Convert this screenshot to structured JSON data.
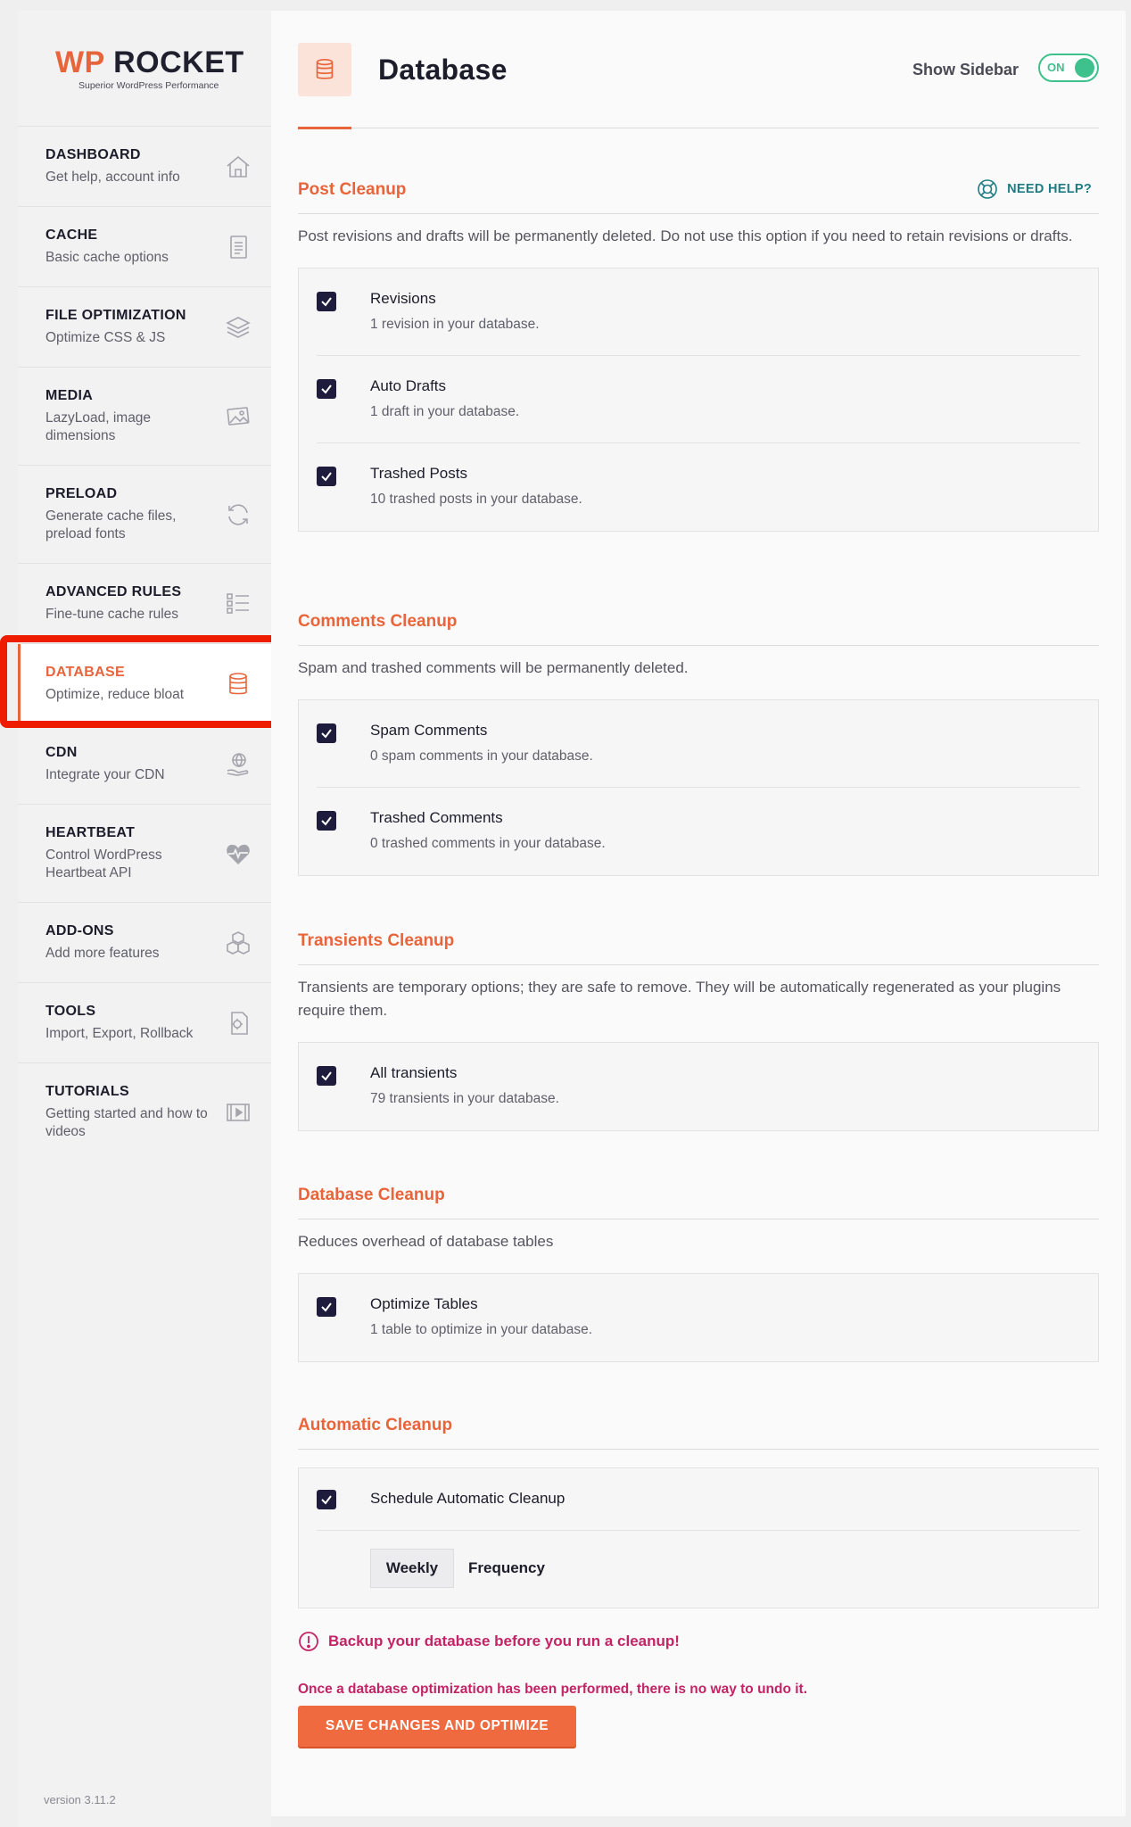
{
  "logo": {
    "brand_wp": "WP",
    "brand_rocket": "ROCKET",
    "tagline": "Superior WordPress Performance"
  },
  "sidebar": {
    "items": [
      {
        "title": "DASHBOARD",
        "desc": "Get help, account info",
        "icon": "home-icon"
      },
      {
        "title": "CACHE",
        "desc": "Basic cache options",
        "icon": "document-icon"
      },
      {
        "title": "FILE OPTIMIZATION",
        "desc": "Optimize CSS & JS",
        "icon": "layers-icon"
      },
      {
        "title": "MEDIA",
        "desc": "LazyLoad, image dimensions",
        "icon": "image-icon"
      },
      {
        "title": "PRELOAD",
        "desc": "Generate cache files, preload fonts",
        "icon": "refresh-icon"
      },
      {
        "title": "ADVANCED RULES",
        "desc": "Fine-tune cache rules",
        "icon": "list-icon"
      },
      {
        "title": "DATABASE",
        "desc": "Optimize, reduce bloat",
        "icon": "database-icon",
        "active": true
      },
      {
        "title": "CDN",
        "desc": "Integrate your CDN",
        "icon": "globe-hand-icon"
      },
      {
        "title": "HEARTBEAT",
        "desc": "Control WordPress Heartbeat API",
        "icon": "heartbeat-icon"
      },
      {
        "title": "ADD-ONS",
        "desc": "Add more features",
        "icon": "boxes-icon"
      },
      {
        "title": "TOOLS",
        "desc": "Import, Export, Rollback",
        "icon": "gear-document-icon"
      },
      {
        "title": "TUTORIALS",
        "desc": "Getting started and how to videos",
        "icon": "video-icon"
      }
    ],
    "version": "version 3.11.2"
  },
  "header": {
    "title": "Database",
    "show_sidebar_label": "Show Sidebar",
    "toggle_state": "ON"
  },
  "sections": {
    "post_cleanup": {
      "title": "Post Cleanup",
      "help": "NEED HELP?",
      "desc": "Post revisions and drafts will be permanently deleted. Do not use this option if you need to retain revisions or drafts.",
      "options": [
        {
          "label": "Revisions",
          "sub": "1 revision in your database."
        },
        {
          "label": "Auto Drafts",
          "sub": "1 draft in your database."
        },
        {
          "label": "Trashed Posts",
          "sub": "10 trashed posts in your database."
        }
      ]
    },
    "comments_cleanup": {
      "title": "Comments Cleanup",
      "desc": "Spam and trashed comments will be permanently deleted.",
      "options": [
        {
          "label": "Spam Comments",
          "sub": "0 spam comments in your database."
        },
        {
          "label": "Trashed Comments",
          "sub": "0 trashed comments in your database."
        }
      ]
    },
    "transients_cleanup": {
      "title": "Transients Cleanup",
      "desc": "Transients are temporary options; they are safe to remove. They will be automatically regenerated as your plugins require them.",
      "options": [
        {
          "label": "All transients",
          "sub": "79 transients in your database."
        }
      ]
    },
    "database_cleanup": {
      "title": "Database Cleanup",
      "desc": "Reduces overhead of database tables",
      "options": [
        {
          "label": "Optimize Tables",
          "sub": "1 table to optimize in your database."
        }
      ]
    },
    "automatic_cleanup": {
      "title": "Automatic Cleanup",
      "option_label": "Schedule Automatic Cleanup",
      "frequency_value": "Weekly",
      "frequency_label": "Frequency"
    }
  },
  "warnings": {
    "backup": "Backup your database before you run a cleanup!",
    "irreversible": "Once a database optimization has been performed, there is no way to undo it."
  },
  "save_button": "SAVE CHANGES AND OPTIMIZE",
  "colors": {
    "accent": "#e8643a",
    "checkbox": "#1f1b3c",
    "toggle_on": "#3ec18d",
    "warning": "#c22466",
    "help": "#1f7c83"
  }
}
